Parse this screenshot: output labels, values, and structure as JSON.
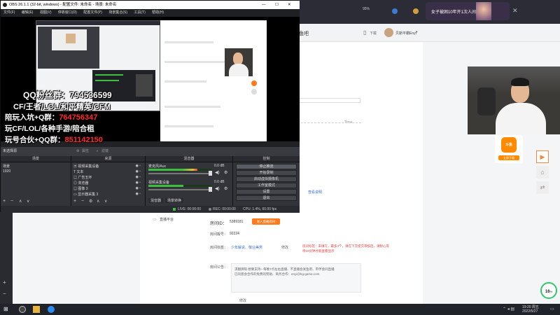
{
  "obs": {
    "title": "OBS 26.1.1 (32-bit, windows) - 配置文件: 未命名 - 场景: 未命名",
    "menu": [
      "文件(F)",
      "编辑(E)",
      "视图(V)",
      "停靠窗口(D)",
      "配置文件(P)",
      "场景集合(S)",
      "工具(T)",
      "帮助(H)"
    ],
    "preview_overlay": {
      "line1": "QQ粉丝群：794536599",
      "line2": "CF/王者/LOL/和平精英/CFM",
      "line3_label": "陪玩入坑+Q群：",
      "line3_value": "764756347",
      "line4": "玩CF/LOL/各种手游/陪合租",
      "line5_label": "玩号合伙+QQ群：",
      "line5_value": "851142150"
    },
    "scene_bar": {
      "left_label": "未选择源",
      "properties": "属性",
      "filters": "滤镜"
    },
    "scenes": {
      "title": "场景",
      "items": [
        "场景",
        "1920"
      ]
    },
    "sources": {
      "title": "来源",
      "items": [
        "视频采集设备",
        "文本",
        "广告五环",
        "浏览器",
        "图像 3",
        "显示器采集 3"
      ]
    },
    "mixer": {
      "title": "混音器",
      "channels": [
        {
          "name": "麦克风/Aux",
          "db": "0.0 dB",
          "level": 0.78
        },
        {
          "name": "视频采集设备",
          "db": "0.0 dB",
          "level": 0.55
        }
      ],
      "tabs": [
        "混音器",
        "场景转换"
      ]
    },
    "controls": {
      "title": "控制",
      "buttons": [
        "停止推流",
        "开始录制",
        "启动虚拟摄像机",
        "工作室模式",
        "设置",
        "退出"
      ]
    },
    "status": {
      "live": "LIVE: 00:00:00",
      "rec": "REC: 00:00:00",
      "cpu": "CPU: 1.4%, 60.00 fps"
    }
  },
  "web": {
    "nav_right_user": "贝斯平霸Enyi",
    "nav_download": "下载",
    "nav_title_fragment": "鱼吧",
    "top_tab": "女子被困10年开1次人间",
    "zoom": "95%",
    "stream_title_fragment": "Ttme",
    "stream_link": "查看说明",
    "sidebar_item": "直播平台",
    "room_id_label": "房间ID：",
    "room_id": "5389181",
    "enter_room_button": "进入直播房间",
    "room_number_label": "房间靓号：",
    "room_number": "92224",
    "room_tags_label": "房间标签：",
    "room_tags": "少年解说、敬业美男",
    "room_tags_edit": "修改",
    "room_tags_tip": "房间标签：未填写，最多4个，请在下方提交审核后，请耐心等待10分钟才能查看显示",
    "announce_label": "房间公告：",
    "announce_text": "求翻牌呀 想要支持~ 每晚7点左右直播、不直播会发鱼吧、带伴会同直播\n已同意会合作的免费的赞助、商务合作：enyi@hg-game.com",
    "announce_edit": "修改",
    "webcam_logo_text": "斗鱼",
    "webcam_button": "立即下载",
    "progress_pct": "16",
    "progress_unit": "%"
  },
  "taskbar": {
    "time": "19:20 周五",
    "date": "2022/5/27"
  }
}
